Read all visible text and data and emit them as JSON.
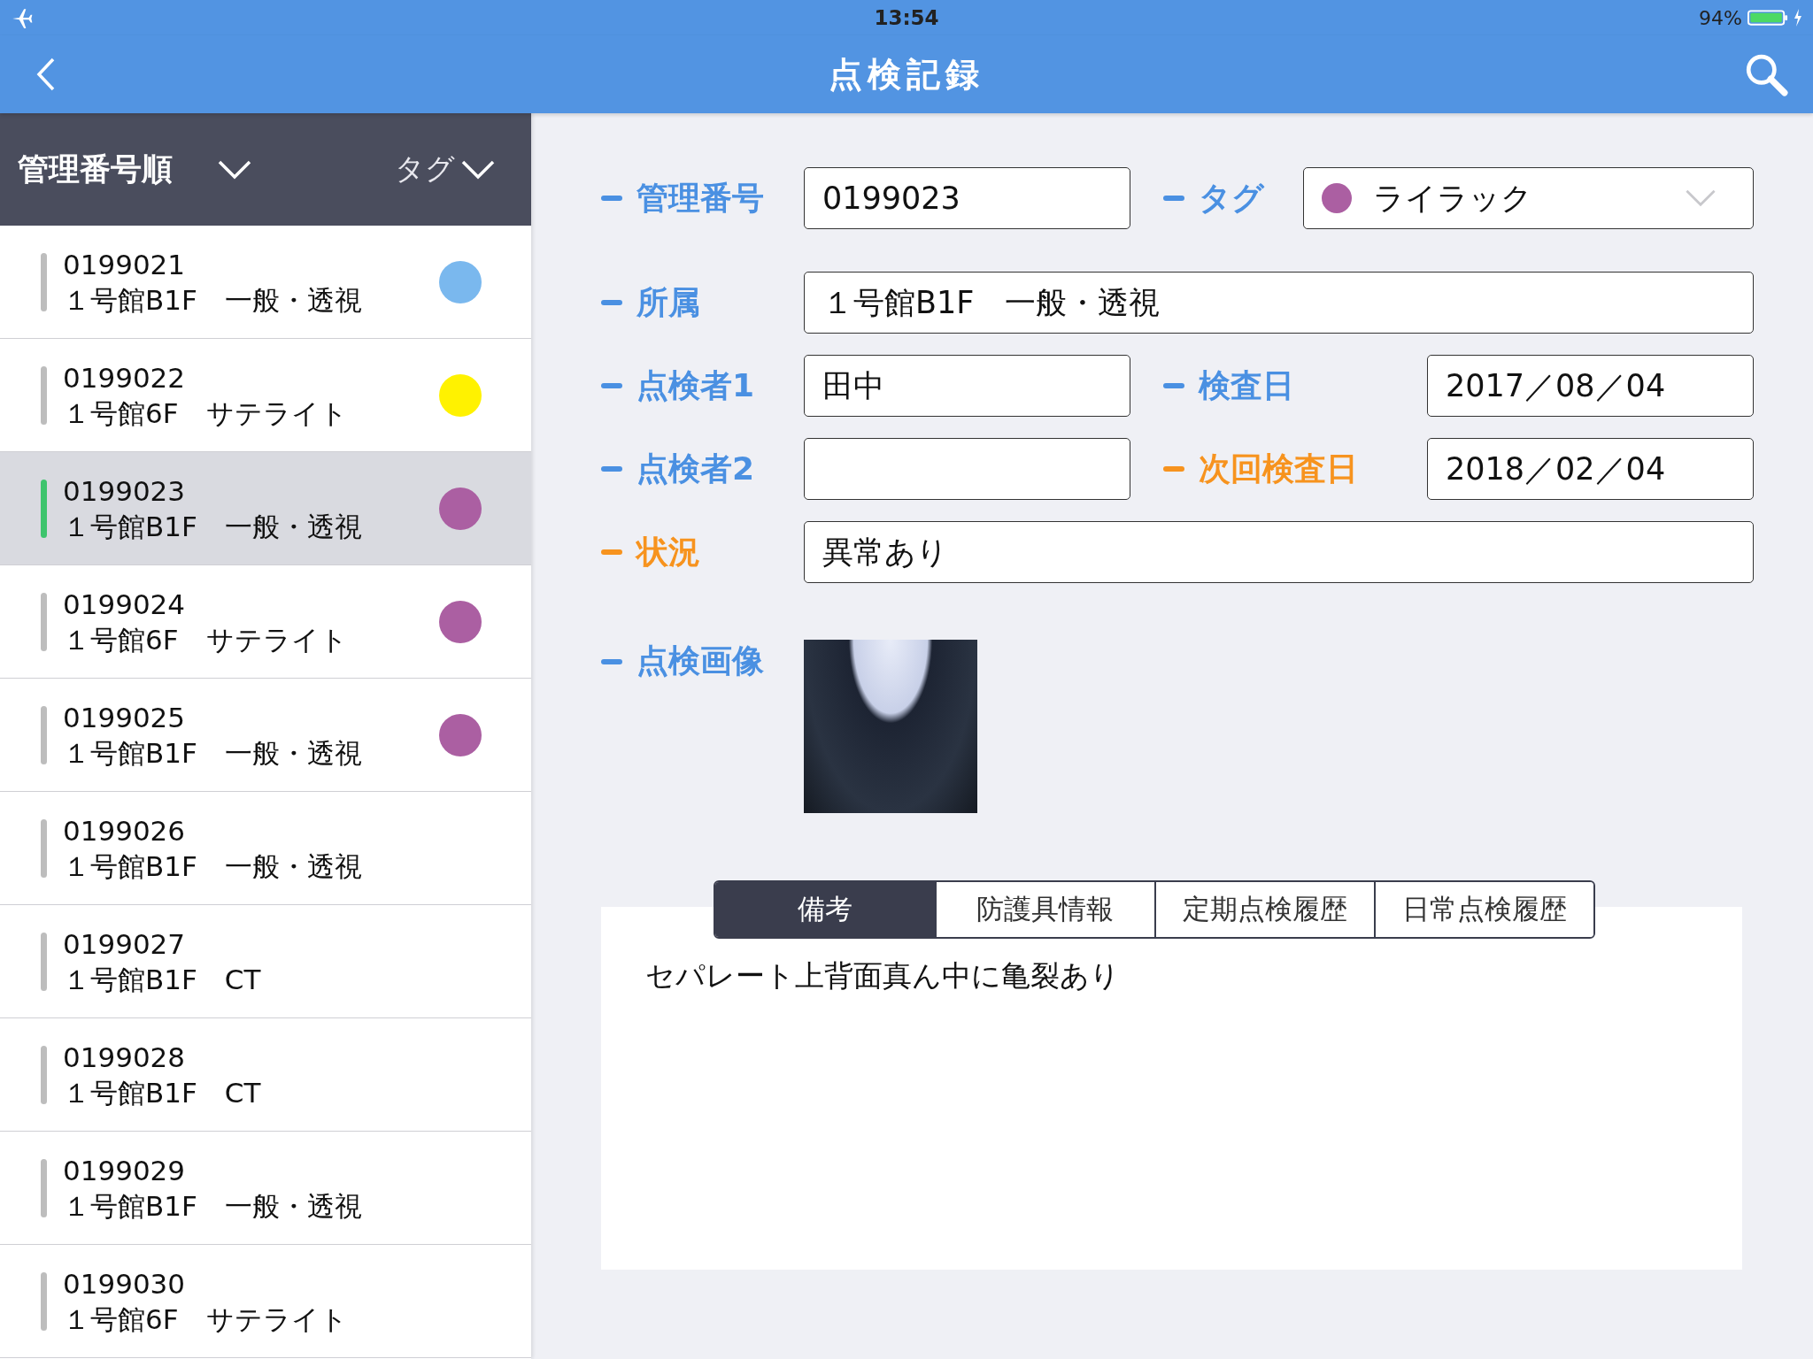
{
  "status_bar": {
    "time": "13:54",
    "battery": "94%"
  },
  "nav": {
    "title": "点検記録"
  },
  "sidebar": {
    "sort_label": "管理番号順",
    "tag_filter": "タグ",
    "items": [
      {
        "number": "0199021",
        "location": "１号館B1F　一般・透視",
        "color": "#7ab8ee",
        "selected": false
      },
      {
        "number": "0199022",
        "location": "１号館6F　サテライト",
        "color": "#fff200",
        "selected": false
      },
      {
        "number": "0199023",
        "location": "１号館B1F　一般・透視",
        "color": "#ab5fa2",
        "selected": true
      },
      {
        "number": "0199024",
        "location": "１号館6F　サテライト",
        "color": "#ab5fa2",
        "selected": false
      },
      {
        "number": "0199025",
        "location": "１号館B1F　一般・透視",
        "color": "#ab5fa2",
        "selected": false
      },
      {
        "number": "0199026",
        "location": "１号館B1F　一般・透視",
        "selected": false
      },
      {
        "number": "0199027",
        "location": "１号館B1F　CT",
        "selected": false
      },
      {
        "number": "0199028",
        "location": "１号館B1F　CT",
        "selected": false
      },
      {
        "number": "0199029",
        "location": "１号館B1F　一般・透視",
        "selected": false
      },
      {
        "number": "0199030",
        "location": "１号館6F　サテライト",
        "selected": false
      }
    ]
  },
  "form": {
    "management_no": {
      "label": "管理番号",
      "value": "0199023",
      "emphasis": false
    },
    "tag": {
      "label": "タグ",
      "value": "ライラック",
      "color": "#ab5fa2",
      "emphasis": false
    },
    "affiliation": {
      "label": "所属",
      "value": "１号館B1F　一般・透視",
      "emphasis": false
    },
    "inspector_1": {
      "label": "点検者1",
      "value": "田中",
      "emphasis": false
    },
    "inspection_date": {
      "label": "検査日",
      "value": "2017／08／04",
      "emphasis": false
    },
    "inspector_2": {
      "label": "点検者2",
      "emphasis": false
    },
    "next_inspection_date": {
      "label": "次回検査日",
      "value": "2018／02／04",
      "emphasis": true
    },
    "condition": {
      "label": "状況",
      "value": "異常あり",
      "emphasis": true
    },
    "image": {
      "label": "点検画像",
      "emphasis": false
    }
  },
  "tabs": [
    {
      "label": "備考",
      "selected": true
    },
    {
      "label": "防護具情報",
      "selected": false
    },
    {
      "label": "定期点検履歴",
      "selected": false
    },
    {
      "label": "日常点検履歴",
      "selected": false
    }
  ],
  "notes": {
    "text": "セパレート上背面真ん中に亀裂あり"
  }
}
